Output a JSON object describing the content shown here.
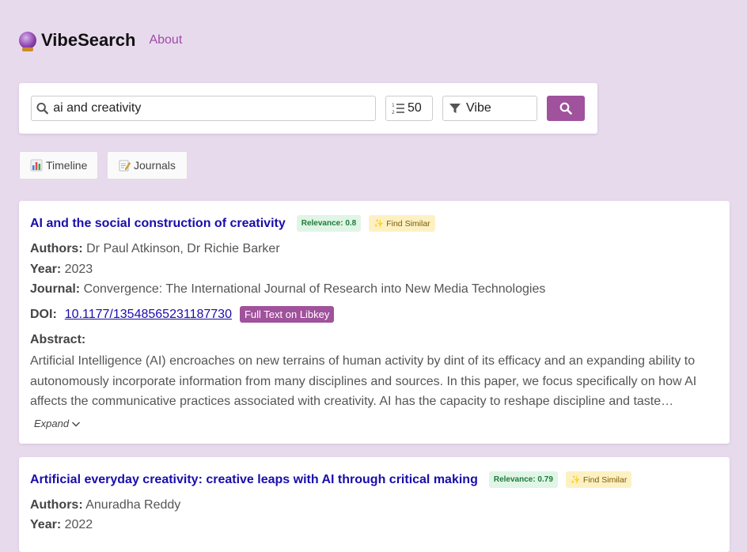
{
  "app": {
    "name": "VibeSearch",
    "about_label": "About"
  },
  "search": {
    "query": "ai and creativity",
    "count": "50",
    "mode": "Vibe"
  },
  "views": {
    "timeline_label": "Timeline",
    "journals_label": "Journals"
  },
  "results": [
    {
      "title": "AI and the social construction of creativity",
      "relevance": "Relevance: 0.8",
      "find_similar": "✨ Find Similar",
      "authors_label": "Authors:",
      "authors": "Dr Paul Atkinson, Dr Richie Barker",
      "year_label": "Year:",
      "year": "2023",
      "journal_label": "Journal:",
      "journal": "Convergence: The International Journal of Research into New Media Technologies",
      "doi_label": "DOI:",
      "doi": "10.1177/13548565231187730",
      "fulltext_label": "Full Text on Libkey",
      "abstract_label": "Abstract:",
      "abstract": "Artificial Intelligence (AI) encroaches on new terrains of human activity by dint of its efficacy and an expanding ability to autonomously incorporate information from many disciplines and sources. In this paper, we focus specifically on how AI affects the communicative practices associated with creativity. AI has the capacity to reshape discipline and taste…",
      "expand_label": "Expand"
    },
    {
      "title": "Artificial everyday creativity: creative leaps with AI through critical making",
      "relevance": "Relevance: 0.79",
      "find_similar": "✨ Find Similar",
      "authors_label": "Authors:",
      "authors": "Anuradha Reddy",
      "year_label": "Year:",
      "year": "2022"
    }
  ]
}
